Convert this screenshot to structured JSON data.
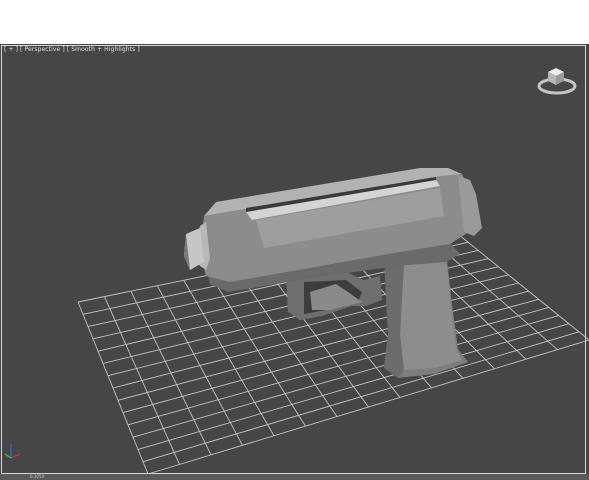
{
  "viewport": {
    "label": {
      "menu": "[ + ]",
      "view": "[ Perspective ]",
      "shading": "[ Smooth + Highlights ]"
    },
    "object": "pistol-mesh",
    "status_value": "0.1059"
  },
  "colors": {
    "viewport_bg": "#464646",
    "grid_line": "#d9d9d9",
    "model": "#8a8a8a",
    "frame": "#d7d7d7",
    "axis_x": "#d23c3c",
    "axis_y": "#3cc83c",
    "axis_z": "#4060e0"
  },
  "icons": {
    "viewcube": "viewcube-icon",
    "axis": "axis-tripod-icon"
  }
}
